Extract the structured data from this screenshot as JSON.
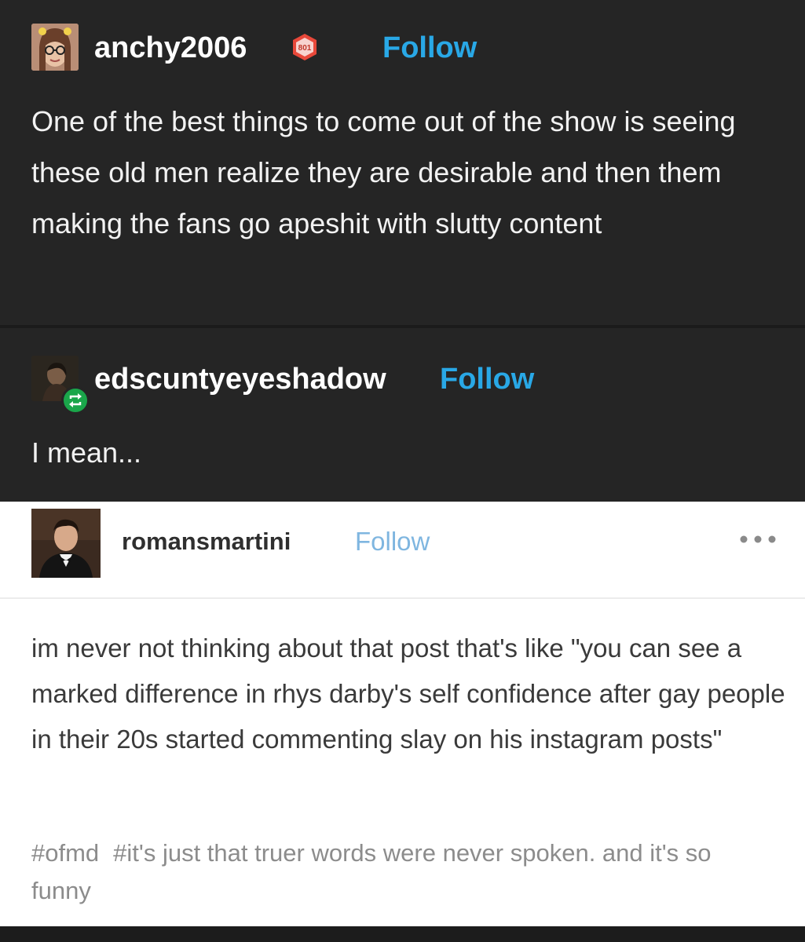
{
  "post1": {
    "username": "anchy2006",
    "badge_text": "801",
    "follow_label": "Follow",
    "body": "One of the best things to come out of the show is seeing these old men realize they are desirable and then them making the fans go apeshit with slutty content",
    "avatar_icon": "avatar-girl-glasses-icon"
  },
  "post2": {
    "username": "edscuntyeyeshadow",
    "follow_label": "Follow",
    "body": "I mean...",
    "reblog_icon": "reblog-icon"
  },
  "embedded": {
    "username": "romansmartini",
    "follow_label": "Follow",
    "more_icon": "more-options-icon",
    "body": "im never not thinking about that post that's like \"you can see a marked difference in rhys darby's self confidence after gay people in their 20s started commenting slay on his instagram posts\"",
    "tags": [
      "#ofmd",
      "#it's just that truer words were never spoken. and it's so funny"
    ]
  },
  "colors": {
    "dark_bg": "#252525",
    "follow_blue": "#29a8e6",
    "light_follow": "#7fb6e0",
    "reblog_green": "#1aa64a"
  }
}
